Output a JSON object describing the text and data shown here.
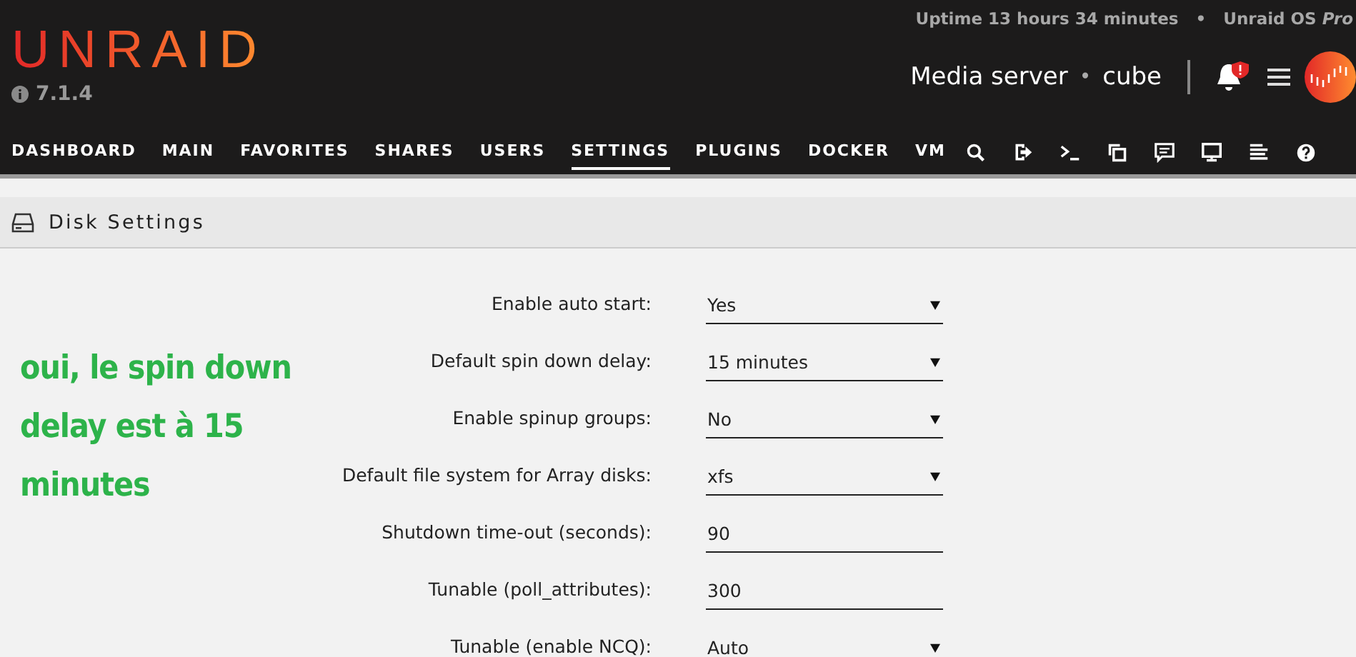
{
  "header": {
    "logo": "UNRAID",
    "version": "7.1.4",
    "uptime": "Uptime 13 hours 34 minutes",
    "separator": "•",
    "license": "Unraid OS *Pro*",
    "server_name": "Media server",
    "server_dot": "•",
    "server_description": "cube"
  },
  "nav": [
    {
      "label": "DASHBOARD",
      "selected": false
    },
    {
      "label": "MAIN",
      "selected": false
    },
    {
      "label": "FAVORITES",
      "selected": false
    },
    {
      "label": "SHARES",
      "selected": false
    },
    {
      "label": "USERS",
      "selected": false
    },
    {
      "label": "SETTINGS",
      "selected": true
    },
    {
      "label": "PLUGINS",
      "selected": false
    },
    {
      "label": "DOCKER",
      "selected": false
    },
    {
      "label": "VM",
      "selected": false
    }
  ],
  "toolbar": [
    {
      "kind": "search"
    },
    {
      "kind": "logout"
    },
    {
      "kind": "terminal"
    },
    {
      "kind": "copy"
    },
    {
      "kind": "chat"
    },
    {
      "kind": "monitor"
    },
    {
      "kind": "log"
    },
    {
      "kind": "help"
    }
  ],
  "panel": {
    "title": "Disk Settings"
  },
  "annotation": "oui, le spin down delay est à 15 minutes",
  "settings": [
    {
      "label": "Enable auto start:",
      "kind": "select",
      "value": "Yes"
    },
    {
      "label": "Default spin down delay:",
      "kind": "select",
      "value": "15 minutes"
    },
    {
      "label": "Enable spinup groups:",
      "kind": "select",
      "value": "No"
    },
    {
      "label": "Default file system for Array disks:",
      "kind": "select",
      "value": "xfs"
    },
    {
      "label": "Shutdown time-out (seconds):",
      "kind": "input",
      "value": "90"
    },
    {
      "label": "Tunable (poll_attributes):",
      "kind": "input",
      "value": "300"
    },
    {
      "label": "Tunable (enable NCQ):",
      "kind": "select",
      "value": "Auto"
    }
  ]
}
